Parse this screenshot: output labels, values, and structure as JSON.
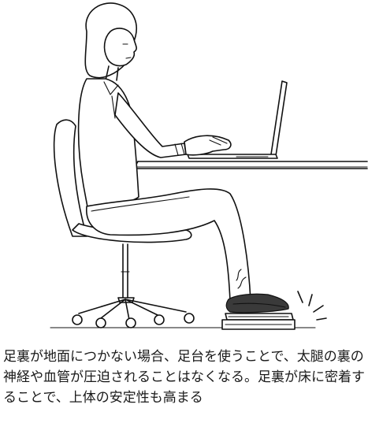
{
  "illustration": {
    "description_icon": "person-seated-at-desk-with-footrest-illustration"
  },
  "caption": {
    "text": "足裏が地面につかない場合、足台を使うことで、太腿の裏の神経や血管が圧迫されることはなくなる。足裏が床に密着することで、上体の安定性も高まる"
  }
}
